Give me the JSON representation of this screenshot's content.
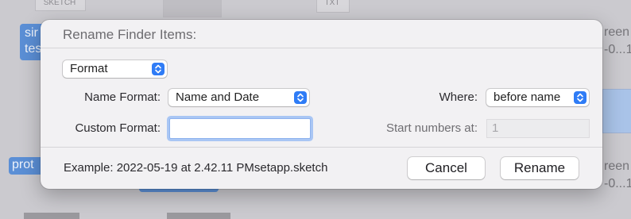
{
  "dialog": {
    "title": "Rename Finder Items:",
    "mode_popup": {
      "value": "Format"
    },
    "name_format": {
      "label": "Name Format:",
      "value": "Name and Date"
    },
    "where": {
      "label": "Where:",
      "value": "before name"
    },
    "custom_format": {
      "label": "Custom Format:",
      "value": ""
    },
    "start_numbers": {
      "label": "Start numbers at:",
      "value": "1"
    },
    "example": "Example: 2022-05-19 at 2.42.11 PMsetapp.sketch",
    "cancel_label": "Cancel",
    "rename_label": "Rename"
  },
  "background": {
    "tag_left": "SKETCH",
    "tag_mid": "TXT",
    "sel_1a": "sir",
    "sel_1b": "tes",
    "sel_2": "prot",
    "right_1": "reen",
    "right_2": "-0...1",
    "right_3": "reen",
    "right_4": "-0...1"
  },
  "colors": {
    "accent": "#2f7cf6",
    "dialog_bg": "#f2f1f3",
    "selection_bg": "#5b8fd6"
  }
}
